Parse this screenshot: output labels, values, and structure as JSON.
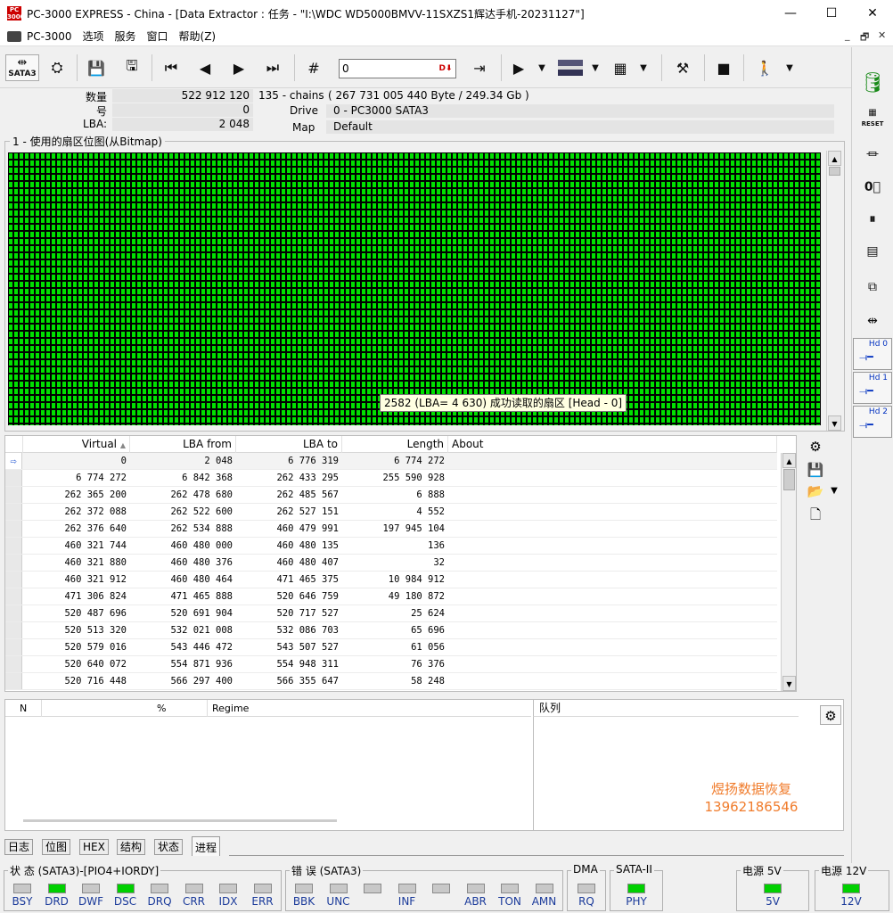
{
  "window": {
    "title": "PC-3000 EXPRESS - China - [Data Extractor : 任务 - \"I:\\WDC WD5000BMVV-11SXZS1辉达手机-20231127\"]",
    "app_icon_text": "PC 3000",
    "min": "—",
    "max": "☐",
    "close": "✕"
  },
  "menu": {
    "app": "PC-3000",
    "items": [
      "选项",
      "服务",
      "窗口",
      "帮助(Z)"
    ],
    "mdi_min": "_",
    "mdi_restore": "🗗",
    "mdi_close": "✕"
  },
  "toolbar": {
    "sata_label": "SATA3",
    "address_value": "0",
    "address_icon": "D⬇"
  },
  "info": {
    "count_label": "数量",
    "count_value": "522 912 120",
    "chains": "135 - chains",
    "bytes": "( 267 731 005 440 Byte /  249.34 Gb )",
    "num_label": "号",
    "num_value": "0",
    "drive_label": "Drive",
    "drive_value": "0 - PC3000 SATA3",
    "lba_label": "LBA:",
    "lba_value": "2 048",
    "map_label": "Map",
    "map_value": "Default"
  },
  "bitmap": {
    "title": "1 - 使用的扇区位图(从Bitmap)",
    "tooltip": "2582 (LBA=  4 630) 成功读取的扇区 [Head - 0]",
    "colors": {
      "ok": "#00e000",
      "grid": "#000000"
    }
  },
  "table": {
    "headers": {
      "virtual": "Virtual",
      "lba_from": "LBA from",
      "lba_to": "LBA to",
      "length": "Length",
      "about": "About"
    },
    "rows": [
      {
        "virtual": "0",
        "from": "2 048",
        "to": "6 776 319",
        "length": "6 774 272"
      },
      {
        "virtual": "6 774 272",
        "from": "6 842 368",
        "to": "262 433 295",
        "length": "255 590 928"
      },
      {
        "virtual": "262 365 200",
        "from": "262 478 680",
        "to": "262 485 567",
        "length": "6 888"
      },
      {
        "virtual": "262 372 088",
        "from": "262 522 600",
        "to": "262 527 151",
        "length": "4 552"
      },
      {
        "virtual": "262 376 640",
        "from": "262 534 888",
        "to": "460 479 991",
        "length": "197 945 104"
      },
      {
        "virtual": "460 321 744",
        "from": "460 480 000",
        "to": "460 480 135",
        "length": "136"
      },
      {
        "virtual": "460 321 880",
        "from": "460 480 376",
        "to": "460 480 407",
        "length": "32"
      },
      {
        "virtual": "460 321 912",
        "from": "460 480 464",
        "to": "471 465 375",
        "length": "10 984 912"
      },
      {
        "virtual": "471 306 824",
        "from": "471 465 888",
        "to": "520 646 759",
        "length": "49 180 872"
      },
      {
        "virtual": "520 487 696",
        "from": "520 691 904",
        "to": "520 717 527",
        "length": "25 624"
      },
      {
        "virtual": "520 513 320",
        "from": "532 021 008",
        "to": "532 086 703",
        "length": "65 696"
      },
      {
        "virtual": "520 579 016",
        "from": "543 446 472",
        "to": "543 507 527",
        "length": "61 056"
      },
      {
        "virtual": "520 640 072",
        "from": "554 871 936",
        "to": "554 948 311",
        "length": "76 376"
      },
      {
        "virtual": "520 716 448",
        "from": "566 297 400",
        "to": "566 355 647",
        "length": "58 248"
      }
    ]
  },
  "process": {
    "col_n": "N",
    "col_pct": "%",
    "col_regime": "Regime",
    "queue_title": "队列",
    "watermark_line1": "煜扬数据恢复",
    "watermark_line2": "13962186546"
  },
  "tabs": [
    "日志",
    "位图",
    "HEX",
    "结构",
    "状态",
    "进程"
  ],
  "status": {
    "state_title": "状 态 (SATA3)-[PIO4+IORDY]",
    "state_leds": [
      {
        "label": "BSY",
        "on": false
      },
      {
        "label": "DRD",
        "on": true
      },
      {
        "label": "DWF",
        "on": false
      },
      {
        "label": "DSC",
        "on": true
      },
      {
        "label": "DRQ",
        "on": false
      },
      {
        "label": "CRR",
        "on": false
      },
      {
        "label": "IDX",
        "on": false
      },
      {
        "label": "ERR",
        "on": false
      }
    ],
    "error_title": "错 误 (SATA3)",
    "error_leds": [
      {
        "label": "BBK",
        "on": false
      },
      {
        "label": "UNC",
        "on": false
      },
      {
        "label": "",
        "on": false
      },
      {
        "label": "INF",
        "on": false
      },
      {
        "label": "",
        "on": false
      },
      {
        "label": "ABR",
        "on": false
      },
      {
        "label": "TON",
        "on": false
      },
      {
        "label": "AMN",
        "on": false
      }
    ],
    "dma_title": "DMA",
    "dma_led": {
      "label": "RQ",
      "on": false
    },
    "sata_title": "SATA-II",
    "sata_led": {
      "label": "PHY",
      "on": true
    },
    "p5_title": "电源 5V",
    "p5_led": {
      "label": "5V",
      "on": true
    },
    "p12_title": "电源 12V",
    "p12_led": {
      "label": "12V",
      "on": true
    }
  },
  "right_panel": {
    "reset_label": "RESET",
    "hd0": "Hd 0",
    "hd1": "Hd 1",
    "hd2": "Hd 2"
  }
}
